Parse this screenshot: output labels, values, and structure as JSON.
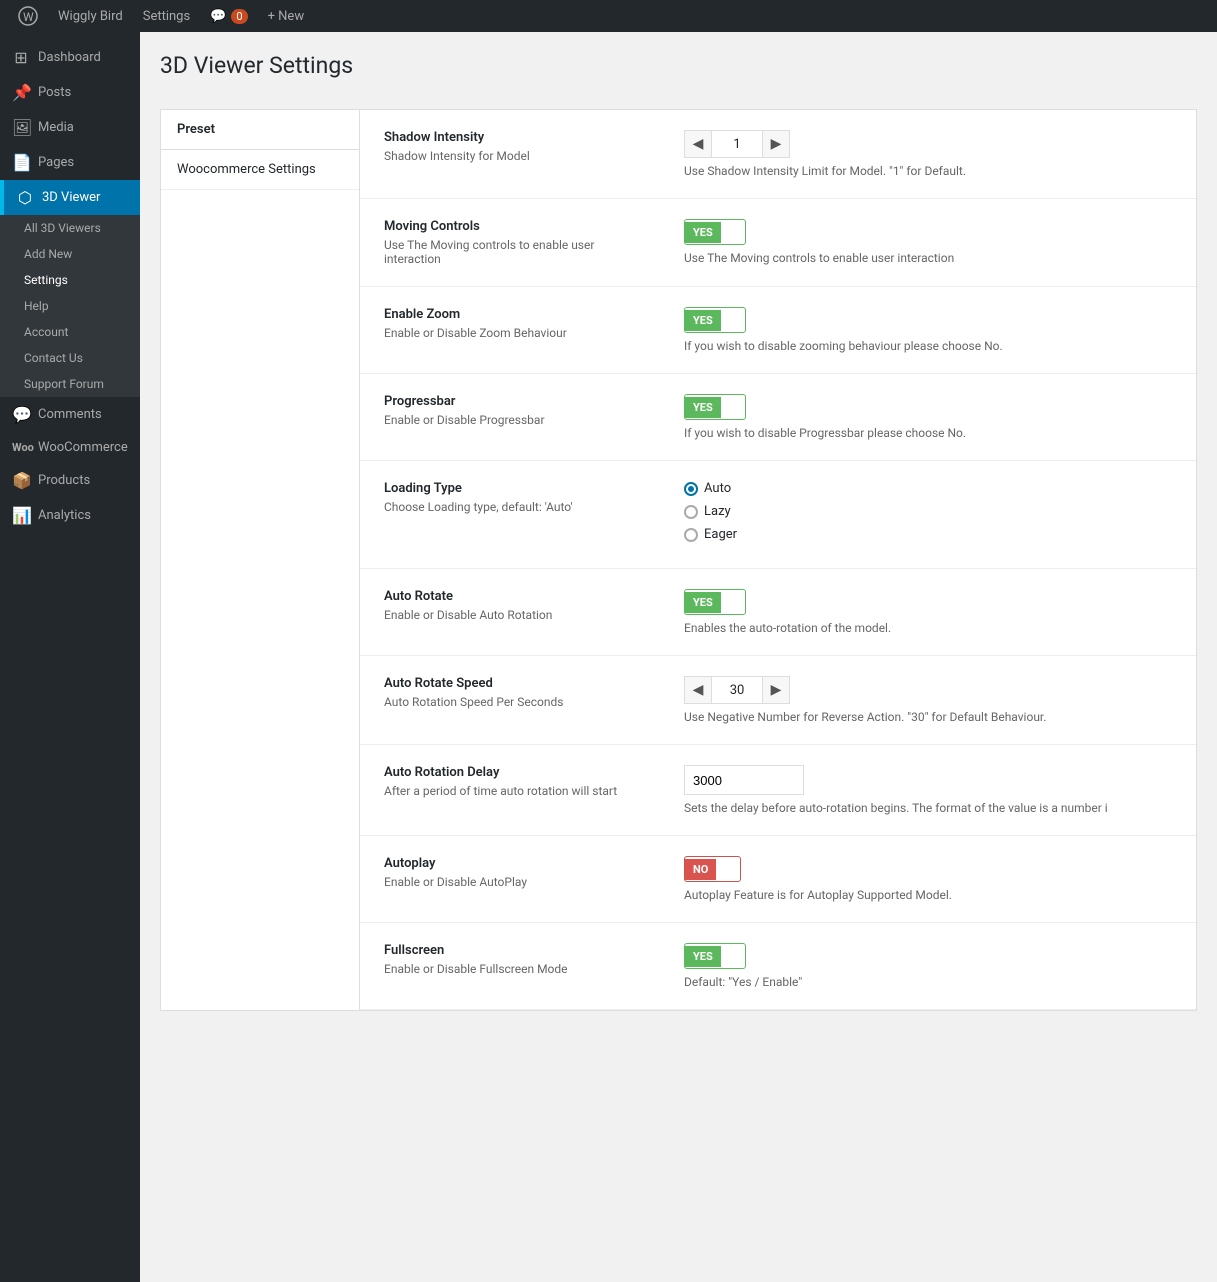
{
  "adminbar": {
    "wp_label": "W",
    "site_label": "Wiggly Bird",
    "settings_label": "Settings",
    "comments_label": "Comments",
    "comments_count": "0",
    "new_label": "+ New"
  },
  "sidebar": {
    "items": [
      {
        "id": "dashboard",
        "label": "Dashboard",
        "icon": "⊞"
      },
      {
        "id": "posts",
        "label": "Posts",
        "icon": "📌"
      },
      {
        "id": "media",
        "label": "Media",
        "icon": "🖼"
      },
      {
        "id": "pages",
        "label": "Pages",
        "icon": "📄"
      },
      {
        "id": "3dviewer",
        "label": "3D Viewer",
        "icon": "⬡",
        "active": true
      },
      {
        "id": "comments",
        "label": "Comments",
        "icon": "💬"
      },
      {
        "id": "woocommerce",
        "label": "WooCommerce",
        "icon": "W"
      },
      {
        "id": "products",
        "label": "Products",
        "icon": "📦"
      },
      {
        "id": "analytics",
        "label": "Analytics",
        "icon": "📊"
      }
    ],
    "submenu_3dviewer": [
      {
        "id": "all",
        "label": "All 3D Viewers"
      },
      {
        "id": "addnew",
        "label": "Add New"
      },
      {
        "id": "settings",
        "label": "Settings",
        "active": true
      },
      {
        "id": "help",
        "label": "Help"
      },
      {
        "id": "account",
        "label": "Account"
      },
      {
        "id": "contactus",
        "label": "Contact Us"
      },
      {
        "id": "supportforum",
        "label": "Support Forum"
      }
    ]
  },
  "page": {
    "title": "3D Viewer Settings"
  },
  "preset": {
    "header": "Preset",
    "items": [
      {
        "label": "Woocommerce Settings"
      }
    ]
  },
  "settings": [
    {
      "id": "shadow-intensity",
      "label": "Shadow Intensity",
      "desc": "Shadow Intensity for Model",
      "type": "stepper",
      "value": "1",
      "hint": "Use Shadow Intensity Limit for Model. \"1\" for Default."
    },
    {
      "id": "moving-controls",
      "label": "Moving Controls",
      "desc": "Use The Moving controls to enable user interaction",
      "type": "toggle",
      "state": "on",
      "hint": "Use The Moving controls to enable user interaction"
    },
    {
      "id": "enable-zoom",
      "label": "Enable Zoom",
      "desc": "Enable or Disable Zoom Behaviour",
      "type": "toggle",
      "state": "on",
      "hint": "If you wish to disable zooming behaviour please choose No."
    },
    {
      "id": "progressbar",
      "label": "Progressbar",
      "desc": "Enable or Disable Progressbar",
      "type": "toggle",
      "state": "on",
      "hint": "If you wish to disable Progressbar please choose No."
    },
    {
      "id": "loading-type",
      "label": "Loading Type",
      "desc": "Choose Loading type, default: 'Auto'",
      "type": "radio",
      "options": [
        "Auto",
        "Lazy",
        "Eager"
      ],
      "selected": "Auto"
    },
    {
      "id": "auto-rotate",
      "label": "Auto Rotate",
      "desc": "Enable or Disable Auto Rotation",
      "type": "toggle",
      "state": "on",
      "hint": "Enables the auto-rotation of the model."
    },
    {
      "id": "auto-rotate-speed",
      "label": "Auto Rotate Speed",
      "desc": "Auto Rotation Speed Per Seconds",
      "type": "stepper",
      "value": "30",
      "hint": "Use Negative Number for Reverse Action. \"30\" for Default Behaviour."
    },
    {
      "id": "auto-rotation-delay",
      "label": "Auto Rotation Delay",
      "desc": "After a period of time auto rotation will start",
      "type": "text",
      "value": "3000",
      "hint": "Sets the delay before auto-rotation begins. The format of the value is a number i"
    },
    {
      "id": "autoplay",
      "label": "Autoplay",
      "desc": "Enable or Disable AutoPlay",
      "type": "toggle",
      "state": "off",
      "hint": "Autoplay Feature is for Autoplay Supported Model."
    },
    {
      "id": "fullscreen",
      "label": "Fullscreen",
      "desc": "Enable or Disable Fullscreen Mode",
      "type": "toggle",
      "state": "on",
      "hint": "Default: \"Yes / Enable\""
    }
  ]
}
